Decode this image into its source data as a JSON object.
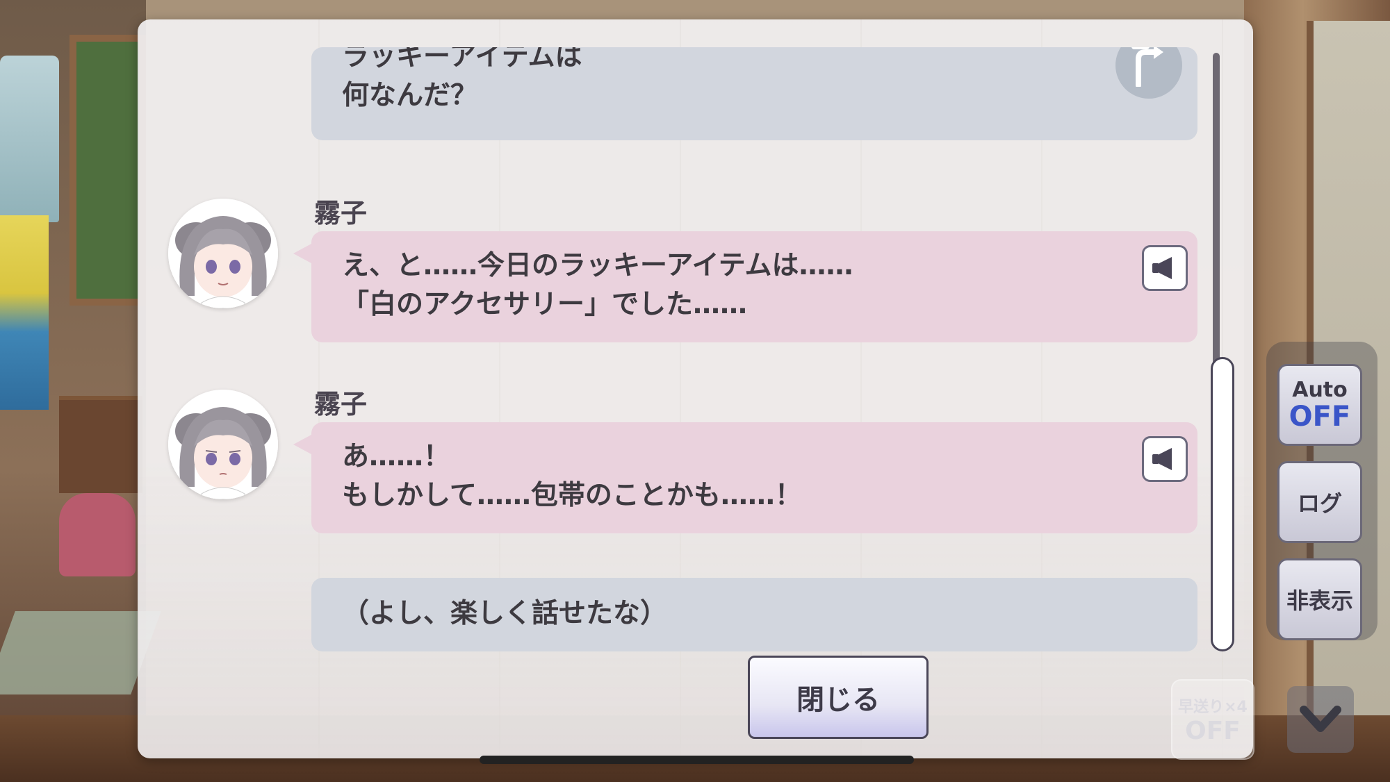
{
  "log": {
    "entries": [
      {
        "type": "narration",
        "lines": [
          "ラッキーアイテムは",
          "何なんだ？"
        ],
        "has_jump": true
      },
      {
        "type": "speech",
        "speaker": "霧子",
        "lines": [
          "え、と……今日のラッキーアイテムは……",
          "「白のアクセサリー」でした……"
        ],
        "has_voice": true
      },
      {
        "type": "speech",
        "speaker": "霧子",
        "lines": [
          "あ……！",
          "もしかして……包帯のことかも……！"
        ],
        "has_voice": true
      },
      {
        "type": "narration",
        "lines": [
          "（よし、楽しく話せたな）"
        ]
      }
    ],
    "close_label": "閉じる"
  },
  "controls": {
    "auto_label": "Auto",
    "auto_state": "OFF",
    "log_label": "ログ",
    "hide_label": "非表示",
    "fast_forward_label": "早送り×4",
    "fast_forward_state": "OFF"
  },
  "icons": {
    "voice": "speaker-icon",
    "jump": "jump-arrow-icon",
    "down": "chevron-down-icon"
  },
  "colors": {
    "narration_bubble": "#d2d6de",
    "speech_bubble": "#ead2dd",
    "auto_off": "#3a55c8"
  }
}
